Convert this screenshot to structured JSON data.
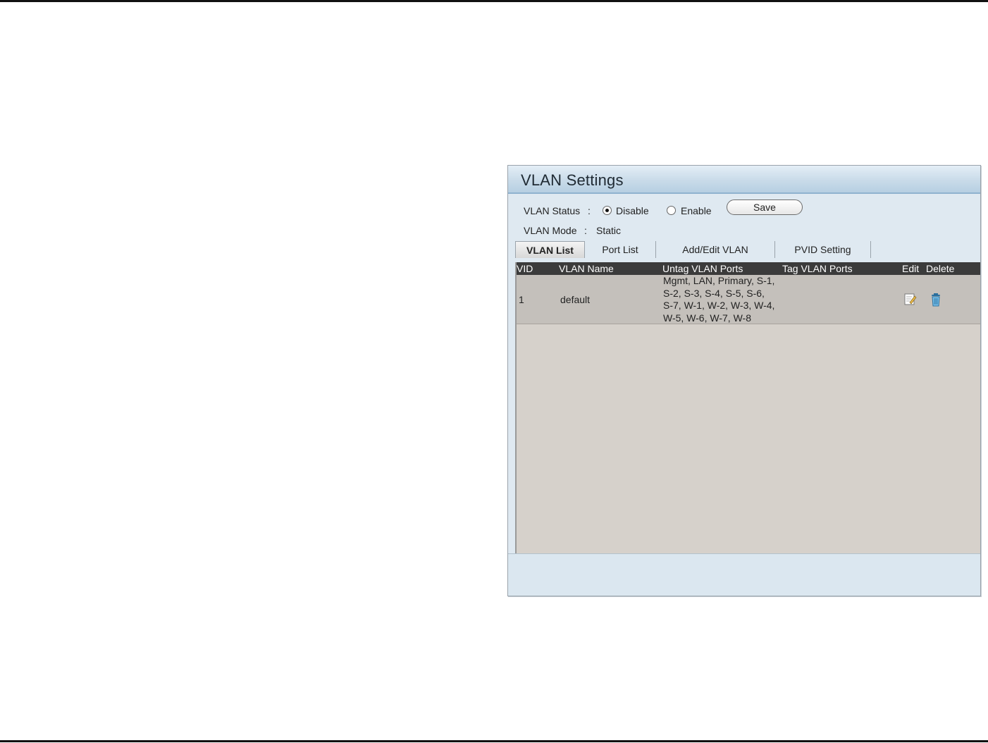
{
  "panel": {
    "title": "VLAN Settings",
    "vlan_status": {
      "label": "VLAN Status",
      "separator": ":",
      "options": [
        "Disable",
        "Enable"
      ],
      "selected": "Disable"
    },
    "vlan_mode": {
      "label": "VLAN Mode",
      "separator": ":",
      "value": "Static"
    },
    "save_label": "Save",
    "tabs": [
      {
        "label": "VLAN List",
        "active": true
      },
      {
        "label": "Port List",
        "active": false
      },
      {
        "label": "Add/Edit VLAN",
        "active": false
      },
      {
        "label": "PVID Setting",
        "active": false
      }
    ],
    "table": {
      "headers": {
        "vid": "VID",
        "name": "VLAN Name",
        "untag": "Untag VLAN Ports",
        "tag": "Tag VLAN Ports",
        "edit": "Edit",
        "delete": "Delete"
      },
      "rows": [
        {
          "vid": "1",
          "name": "default",
          "untag_lines": [
            "Mgmt, LAN, Primary, S-1,",
            "S-2, S-3, S-4, S-5, S-6,",
            "S-7, W-1, W-2, W-3, W-4,",
            "W-5, W-6, W-7, W-8"
          ],
          "tag": ""
        }
      ]
    }
  },
  "icons": {
    "edit": "edit-icon",
    "delete": "trash-icon"
  },
  "colors": {
    "table_header_bg": "#3b3b3b",
    "table_bg": "#d6d1cb",
    "row_bg": "#c4c0bb",
    "panel_bg": "#dfe9f1",
    "header_accent": "#8fb3cf"
  }
}
